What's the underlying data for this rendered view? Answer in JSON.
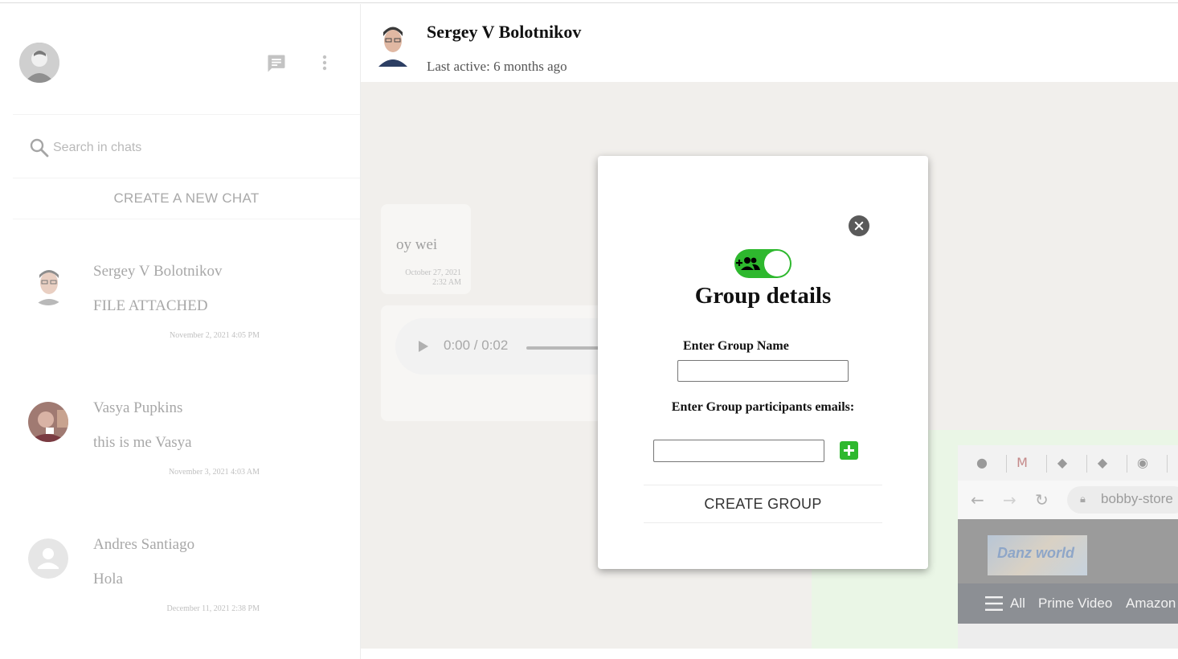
{
  "sidebar": {
    "search_placeholder": "Search in chats",
    "new_chat_label": "CREATE A NEW CHAT",
    "chats": [
      {
        "name": "Sergey V Bolotnikov",
        "message": "FILE ATTACHED",
        "time": "November 2, 2021 4:05 PM"
      },
      {
        "name": "Vasya Pupkins",
        "message": "this is me Vasya",
        "time": "November 3, 2021 4:03 AM"
      },
      {
        "name": "Andres Santiago",
        "message": "Hola",
        "time": "December 11, 2021 2:38 PM"
      }
    ]
  },
  "header": {
    "name": "Sergey V Bolotnikov",
    "status": "Last active: 6 months ago"
  },
  "messages": {
    "text": "oy wei",
    "date_line1": "October 27, 2021",
    "date_line2": "2:32 AM",
    "audio_time": "0:00 / 0:02"
  },
  "browser": {
    "url": "bobby-store",
    "menu_all": "All",
    "menu_prime": "Prime Video",
    "menu_amazon": "Amazon",
    "logo_text": "Danz world"
  },
  "modal": {
    "title": "Group details",
    "group_name_label": "Enter Group Name",
    "group_name_value": "",
    "emails_label": "Enter Group participants emails:",
    "email_value": "",
    "create_label": "CREATE GROUP",
    "toggle_on": true
  },
  "colors": {
    "accent_green": "#2eb82e",
    "chat_bg": "#f1efec"
  }
}
